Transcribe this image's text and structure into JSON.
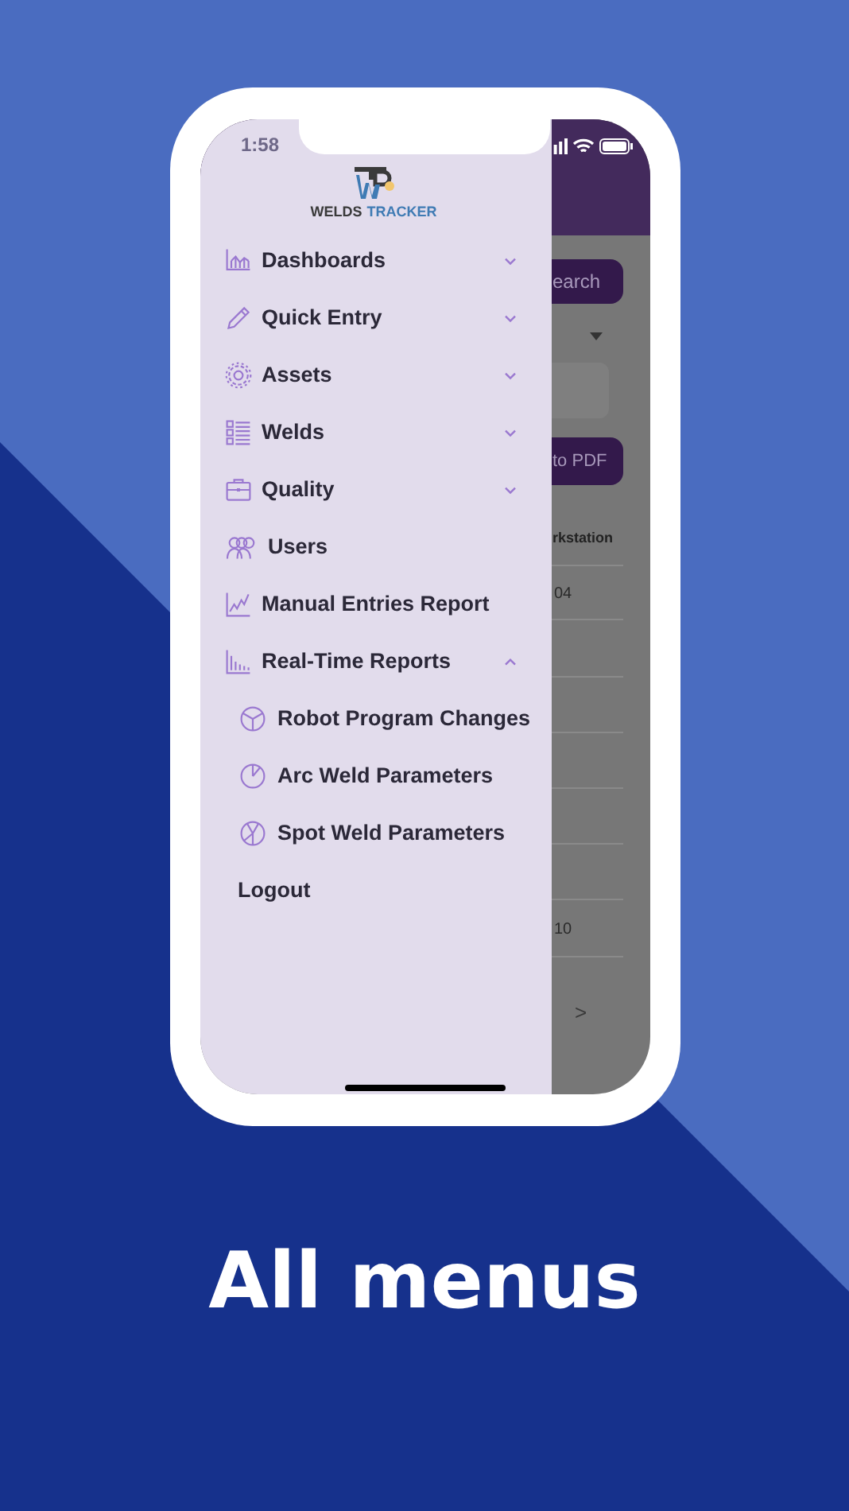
{
  "status_bar": {
    "time": "1:58"
  },
  "logo": {
    "word_1": "WELDS",
    "word_2": "TRACKER"
  },
  "menu": [
    {
      "label": "Dashboards",
      "kind": "group",
      "expanded": false
    },
    {
      "label": "Quick Entry",
      "kind": "group",
      "expanded": false
    },
    {
      "label": "Assets",
      "kind": "group",
      "expanded": false
    },
    {
      "label": "Welds",
      "kind": "group",
      "expanded": false
    },
    {
      "label": "Quality",
      "kind": "group",
      "expanded": false
    },
    {
      "label": "Users",
      "kind": "link"
    },
    {
      "label": "Manual Entries Report",
      "kind": "link"
    },
    {
      "label": "Real-Time Reports",
      "kind": "group",
      "expanded": true,
      "children": [
        {
          "label": "Robot Program Changes"
        },
        {
          "label": "Arc Weld Parameters"
        },
        {
          "label": "Spot Weld Parameters"
        }
      ]
    },
    {
      "label": "Logout",
      "kind": "plain"
    }
  ],
  "background_screen": {
    "search_button": "earch",
    "export_button": "to PDF",
    "column_header": "rkstation",
    "cells": [
      "04",
      "10"
    ],
    "next_button": ">"
  },
  "caption": "All menus"
}
